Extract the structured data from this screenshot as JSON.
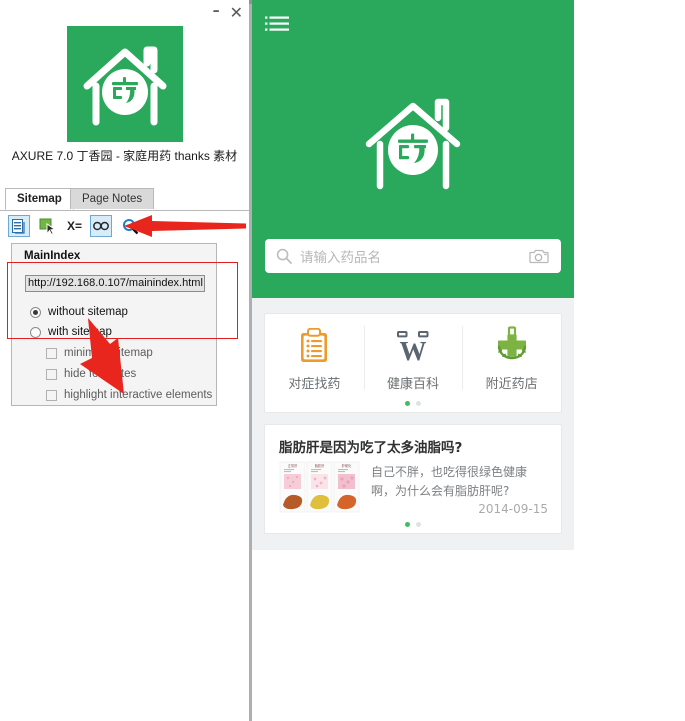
{
  "window": {
    "minimize_label": "–",
    "close_label": "✕",
    "app_title": "AXURE 7.0 丁香园 - 家庭用药 thanks 素材",
    "logo_icon": "pharmacy-house-icon"
  },
  "tabs": [
    {
      "label": "Sitemap",
      "active": true
    },
    {
      "label": "Page Notes",
      "active": false
    }
  ],
  "toolbar": {
    "items": [
      {
        "name": "page-document-icon",
        "label": "",
        "boxed": true
      },
      {
        "name": "cursor-select-icon",
        "label": "",
        "boxed": false
      },
      {
        "name": "variables-x-icon",
        "label": "X=",
        "boxed": false
      },
      {
        "name": "link-chain-icon",
        "label": "",
        "boxed": true
      },
      {
        "name": "search-magnifier-icon",
        "label": "",
        "boxed": false
      }
    ]
  },
  "sitemap_panel": {
    "heading": "MainIndex",
    "url_value": "http://192.168.0.107/mainindex.html",
    "url_placeholder": "http://",
    "radio_options": [
      {
        "label": "without sitemap",
        "checked": true
      },
      {
        "label": "with sitemap",
        "checked": false
      }
    ],
    "checkbox_options": [
      {
        "label": "minimize sitemap",
        "checked": false
      },
      {
        "label": "hide footnotes",
        "checked": false
      },
      {
        "label": "highlight interactive elements",
        "checked": false
      }
    ]
  },
  "annotations": {
    "arrow_toolbar": "red-arrow-pointing-to-search-icon",
    "arrow_radio": "red-arrow-pointing-to-radio-group",
    "highlight_rect": "red-highlight-rectangle",
    "accent_color": "#e02020"
  },
  "prototype": {
    "brand_green": "#2aa85c",
    "header": {
      "menu_icon": "hamburger-list-icon",
      "logo_icon": "pharmacy-house-icon"
    },
    "search": {
      "placeholder": "请输入药品名",
      "search_icon": "search-magnifier-icon",
      "camera_icon": "camera-icon"
    },
    "quick_entries": {
      "items": [
        {
          "label": "对症找药",
          "icon": "clipboard-icon",
          "color": "#ef9a2c"
        },
        {
          "label": "健康百科",
          "icon": "wiki-w-icon",
          "color": "#5a6571"
        },
        {
          "label": "附近药店",
          "icon": "pharmacy-cross-icon",
          "color": "#7cb342"
        }
      ],
      "page_dots": {
        "count": 2,
        "active": 0
      }
    },
    "article": {
      "title": "脂肪肝是因为吃了太多油脂吗?",
      "summary": "自己不胖，也吃得很绿色健康啊，为什么会有脂肪肝呢?",
      "date": "2014-09-15",
      "thumbnail": "liver-comparison-images",
      "page_dots": {
        "count": 2,
        "active": 0
      }
    }
  }
}
